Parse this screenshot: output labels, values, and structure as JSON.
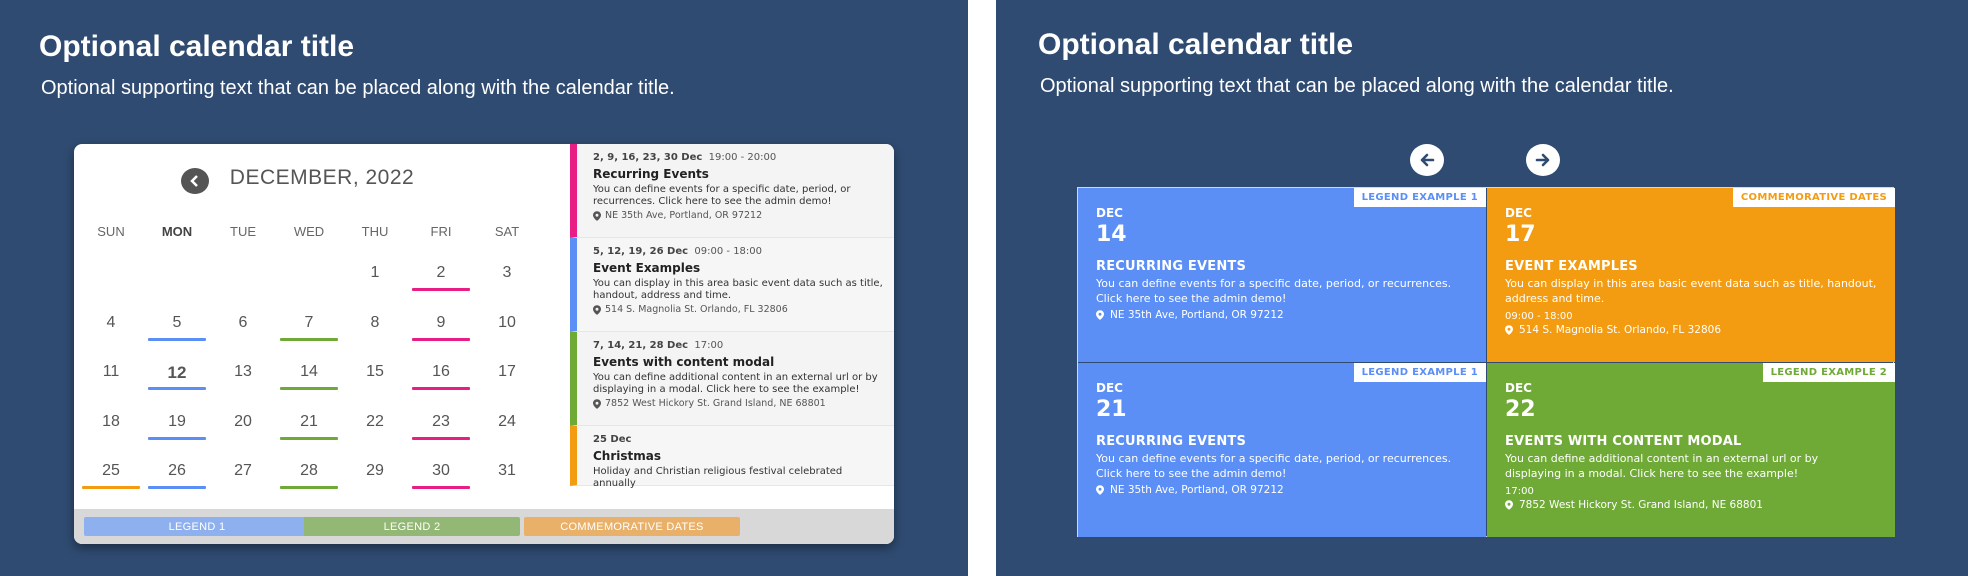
{
  "colors": {
    "background": "#2f4b71",
    "legend1": "#5b8ff5",
    "legend2": "#6faa36",
    "commemorative": "#f39c12",
    "pink": "#e91e84",
    "orange": "#f39c12"
  },
  "left": {
    "title": "Optional calendar title",
    "subtitle": "Optional supporting text that can be placed along with the calendar title.",
    "calendar": {
      "month_label": "DECEMBER, 2022",
      "prev_icon": "chevron-left-icon",
      "next_icon": "chevron-right-icon",
      "weekdays": [
        "SUN",
        "MON",
        "TUE",
        "WED",
        "THU",
        "FRI",
        "SAT"
      ],
      "weeks": [
        [
          {
            "d": ""
          },
          {
            "d": ""
          },
          {
            "d": ""
          },
          {
            "d": ""
          },
          {
            "d": "1"
          },
          {
            "d": "2",
            "bar": "pink"
          },
          {
            "d": "3"
          }
        ],
        [
          {
            "d": "4"
          },
          {
            "d": "5",
            "bar": "legend1"
          },
          {
            "d": "6"
          },
          {
            "d": "7",
            "bar": "legend2"
          },
          {
            "d": "8"
          },
          {
            "d": "9",
            "bar": "pink"
          },
          {
            "d": "10"
          }
        ],
        [
          {
            "d": "11"
          },
          {
            "d": "12",
            "bar": "legend1",
            "bold": true
          },
          {
            "d": "13"
          },
          {
            "d": "14",
            "bar": "legend2"
          },
          {
            "d": "15"
          },
          {
            "d": "16",
            "bar": "pink"
          },
          {
            "d": "17"
          }
        ],
        [
          {
            "d": "18"
          },
          {
            "d": "19",
            "bar": "legend1"
          },
          {
            "d": "20"
          },
          {
            "d": "21",
            "bar": "legend2"
          },
          {
            "d": "22"
          },
          {
            "d": "23",
            "bar": "pink"
          },
          {
            "d": "24"
          }
        ],
        [
          {
            "d": "25",
            "bar": "orange"
          },
          {
            "d": "26",
            "bar": "legend1"
          },
          {
            "d": "27"
          },
          {
            "d": "28",
            "bar": "legend2"
          },
          {
            "d": "29"
          },
          {
            "d": "30",
            "bar": "pink"
          },
          {
            "d": "31"
          }
        ]
      ]
    },
    "events": [
      {
        "dates": "2, 9, 16, 23, 30 Dec",
        "time": "19:00 - 20:00",
        "title": "Recurring Events",
        "desc": "You can define events for a specific date, period, or recurrences. Click here to see the admin demo!",
        "addr": "NE 35th Ave, Portland, OR 97212",
        "color": "pink"
      },
      {
        "dates": "5, 12, 19, 26 Dec",
        "time": "09:00 - 18:00",
        "title": "Event Examples",
        "desc": "You can display in this area basic event data such as title, handout, address and time.",
        "addr": "514 S. Magnolia St. Orlando, FL 32806",
        "color": "legend1"
      },
      {
        "dates": "7, 14, 21, 28 Dec",
        "time": "17:00",
        "title": "Events with content modal",
        "desc": "You can define additional content in an external url or by displaying in a modal. Click here to see the example!",
        "addr": "7852 West Hickory St. Grand Island, NE 68801",
        "color": "legend2"
      },
      {
        "dates": "25 Dec",
        "time": "",
        "title": "Christmas",
        "desc": "Holiday and Christian religious festival celebrated annually",
        "addr": "",
        "color": "orange"
      }
    ],
    "legend": [
      "LEGEND 1",
      "LEGEND 2",
      "COMMEMORATIVE DATES"
    ]
  },
  "right": {
    "title": "Optional calendar title",
    "subtitle": "Optional supporting text that can be placed along with the calendar title.",
    "prev_icon": "arrow-left-icon",
    "next_icon": "arrow-right-icon",
    "tiles": [
      {
        "tag": "LEGEND EXAMPLE 1",
        "month": "DEC",
        "day": "14",
        "title": "RECURRING EVENTS",
        "desc": "You can define events for a specific date, period, or recurrences. Click here to see the admin demo!",
        "time": "",
        "addr": "NE 35th Ave, Portland, OR 97212",
        "color": "legend1"
      },
      {
        "tag": "COMMEMORATIVE DATES",
        "month": "DEC",
        "day": "17",
        "title": "EVENT EXAMPLES",
        "desc": "You can display in this area basic event data such as title, handout, address and time.",
        "time": "09:00 - 18:00",
        "addr": "514 S. Magnolia St. Orlando, FL 32806",
        "color": "commemorative"
      },
      {
        "tag": "LEGEND EXAMPLE 1",
        "month": "DEC",
        "day": "21",
        "title": "RECURRING EVENTS",
        "desc": "You can define events for a specific date, period, or recurrences. Click here to see the admin demo!",
        "time": "",
        "addr": "NE 35th Ave, Portland, OR 97212",
        "color": "legend1"
      },
      {
        "tag": "LEGEND EXAMPLE 2",
        "month": "DEC",
        "day": "22",
        "title": "EVENTS WITH CONTENT MODAL",
        "desc": "You can define additional content in an external url or by displaying in a modal. Click here to see the example!",
        "time": "17:00",
        "addr": "7852 West Hickory St. Grand Island, NE 68801",
        "color": "legend2"
      }
    ]
  }
}
